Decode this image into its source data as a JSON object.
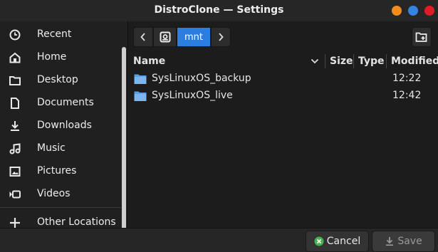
{
  "window": {
    "title": "DistroClone — Settings",
    "controls": {
      "minimize_color": "#f08c1c",
      "maximize_color": "#3584e4",
      "close_color": "#e01b24"
    }
  },
  "sidebar": {
    "items": [
      {
        "label": "Recent",
        "icon": "clock-icon"
      },
      {
        "label": "Home",
        "icon": "home-icon"
      },
      {
        "label": "Desktop",
        "icon": "folder-icon"
      },
      {
        "label": "Documents",
        "icon": "document-icon"
      },
      {
        "label": "Downloads",
        "icon": "download-icon"
      },
      {
        "label": "Music",
        "icon": "music-icon"
      },
      {
        "label": "Pictures",
        "icon": "picture-icon"
      },
      {
        "label": "Videos",
        "icon": "video-icon"
      },
      {
        "label": "Other Locations",
        "icon": "plus-icon"
      }
    ]
  },
  "pathbar": {
    "current": "mnt",
    "accent": "#2b7de0"
  },
  "columns": {
    "name": "Name",
    "size": "Size",
    "type": "Type",
    "modified": "Modified"
  },
  "files": [
    {
      "name": "SysLinuxOS_backup",
      "modified": "12:22"
    },
    {
      "name": "SysLinuxOS_live",
      "modified": "12:42"
    }
  ],
  "buttons": {
    "cancel": "Cancel",
    "save": "Save"
  }
}
